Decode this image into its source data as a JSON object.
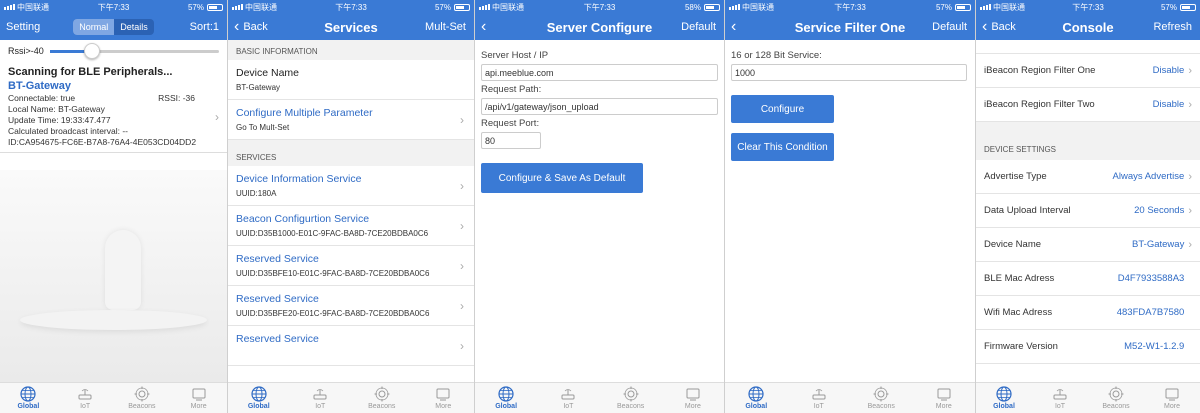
{
  "status": [
    {
      "carrier": "中国联通",
      "time": "下午7:33",
      "battery": "57%"
    },
    {
      "carrier": "中国联通",
      "time": "下午7:33",
      "battery": "57%"
    },
    {
      "carrier": "中国联通",
      "time": "下午7:33",
      "battery": "58%"
    },
    {
      "carrier": "中国联通",
      "time": "下午7:33",
      "battery": "57%"
    },
    {
      "carrier": "中国联通",
      "time": "下午7:33",
      "battery": "57%"
    }
  ],
  "tabs": [
    "Global",
    "IoT",
    "Beacons",
    "More"
  ],
  "scan": {
    "nav_left": "Setting",
    "seg_normal": "Normal",
    "seg_details": "Details",
    "nav_right": "Sort:1",
    "rssi_label": "Rssi>-40",
    "rssi_slider": 0.25,
    "title": "Scanning for BLE Peripherals...",
    "device": {
      "name": "BT-Gateway",
      "connectable": "Connectable: true",
      "rssi": "RSSI: -36",
      "local_name": "Local Name: BT-Gateway",
      "update_time": "Update Time: 19:33:47.477",
      "interval": "Calculated broadcast interval: --",
      "id": "ID:CA954675-FC6E-B7A8-76A4-4E053CD04DD2"
    }
  },
  "services": {
    "back": "Back",
    "title": "Services",
    "right": "Mult-Set",
    "basic_hdr": "BASIC INFORMATION",
    "device_name_t": "Device Name",
    "device_name_s": "BT-Gateway",
    "config_t": "Configure Multiple Parameter",
    "config_s": "Go To Mult-Set",
    "services_hdr": "SERVICES",
    "items": [
      {
        "t": "Device Information Service",
        "s": "UUID:180A"
      },
      {
        "t": "Beacon Configurtion Service",
        "s": "UUID:D35B1000-E01C-9FAC-BA8D-7CE20BDBA0C6"
      },
      {
        "t": "Reserved Service",
        "s": "UUID:D35BFE10-E01C-9FAC-BA8D-7CE20BDBA0C6"
      },
      {
        "t": "Reserved Service",
        "s": "UUID:D35BFE20-E01C-9FAC-BA8D-7CE20BDBA0C6"
      },
      {
        "t": "Reserved Service",
        "s": ""
      }
    ]
  },
  "server": {
    "title": "Server Configure",
    "right": "Default",
    "host_label": "Server Host / IP",
    "host_value": "api.meeblue.com",
    "path_label": "Request Path:",
    "path_value": "/api/v1/gateway/json_upload",
    "port_label": "Request Port:",
    "port_value": "80",
    "button": "Configure & Save As Default"
  },
  "filter": {
    "title": "Service Filter One",
    "right": "Default",
    "label": "16 or 128 Bit Service:",
    "value": "1000",
    "configure": "Configure",
    "clear": "Clear This Condition"
  },
  "console": {
    "back": "Back",
    "title": "Console",
    "right": "Refresh",
    "top_rows": [
      {
        "label": "iBeacon Region Filter One",
        "value": "Disable",
        "chev": true
      },
      {
        "label": "iBeacon Region Filter Two",
        "value": "Disable",
        "chev": true
      }
    ],
    "settings_hdr": "DEVICE SETTINGS",
    "rows": [
      {
        "label": "Advertise Type",
        "value": "Always Advertise",
        "chev": true
      },
      {
        "label": "Data Upload Interval",
        "value": "20 Seconds",
        "chev": true
      },
      {
        "label": "Device Name",
        "value": "BT-Gateway",
        "chev": true
      },
      {
        "label": "BLE Mac Adress",
        "value": "D4F7933588A3",
        "chev": false
      },
      {
        "label": "Wifi Mac Adress",
        "value": "483FDA7B7580",
        "chev": false
      },
      {
        "label": "Firmware Version",
        "value": "M52-W1-1.2.9",
        "chev": false
      }
    ]
  },
  "colors": {
    "primary": "#3a7ad5",
    "link": "#2f6bc5"
  }
}
